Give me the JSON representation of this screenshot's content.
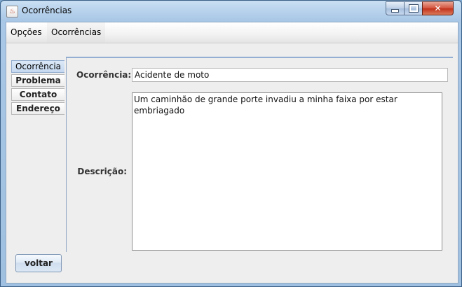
{
  "window": {
    "title": "Ocorrências",
    "app_icon": "java-icon"
  },
  "menubar": {
    "items": [
      {
        "label": "Opções"
      },
      {
        "label": "Ocorrências"
      }
    ]
  },
  "tabs": [
    {
      "label": "Ocorrência",
      "selected": true
    },
    {
      "label": "Problema",
      "selected": false
    },
    {
      "label": "Contato",
      "selected": false
    },
    {
      "label": "Endereço",
      "selected": false
    }
  ],
  "form": {
    "ocorrencia_label": "Ocorrência:",
    "ocorrencia_value": "Acidente de moto",
    "descricao_label": "Descrição:",
    "descricao_value": "Um caminhão de grande porte invadiu a minha faixa por estar embriagado"
  },
  "buttons": {
    "voltar": "voltar"
  }
}
